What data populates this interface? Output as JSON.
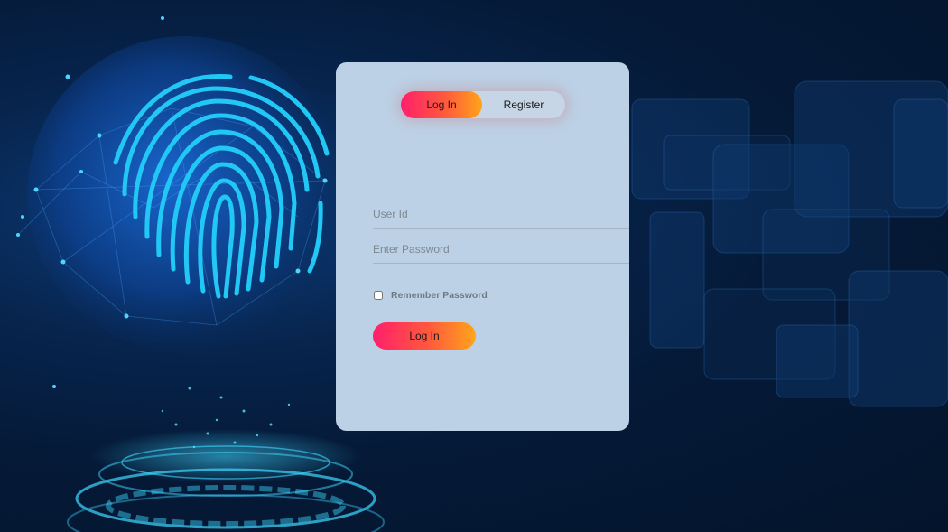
{
  "toggle": {
    "login_label": "Log In",
    "register_label": "Register",
    "active": "login"
  },
  "form": {
    "user_placeholder": "User Id",
    "user_value": "",
    "password_placeholder": "Enter Password",
    "password_value": "",
    "remember_label": "Remember Password",
    "remember_checked": false,
    "submit_label": "Log In"
  },
  "colors": {
    "card_bg": "#bcd1e6",
    "accent_start": "#ff1f6b",
    "accent_end": "#ffa51a",
    "background": "#04142b",
    "fingerprint": "#22c8f5"
  },
  "icons": {
    "background_illustration": "fingerprint-globe-icon"
  }
}
